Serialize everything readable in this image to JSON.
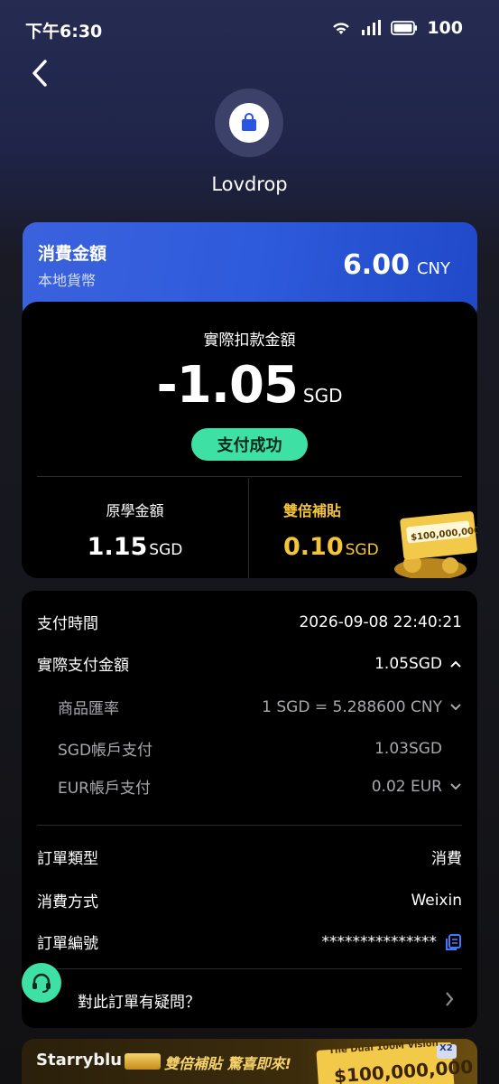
{
  "status_bar": {
    "time": "下午6:30",
    "battery": "100"
  },
  "merchant": {
    "name": "Lovdrop"
  },
  "spend_card": {
    "title": "消費金額",
    "subtitle": "本地貨幣",
    "amount": "6.00",
    "currency": "CNY"
  },
  "payment": {
    "title": "實際扣款金額",
    "amount": "-1.05",
    "currency": "SGD",
    "status": "支付成功",
    "original_label": "原學金額",
    "original_amount": "1.15",
    "original_currency": "SGD",
    "subsidy_label": "雙倍補貼",
    "subsidy_amount": "0.10",
    "subsidy_currency": "SGD"
  },
  "details": {
    "pay_time": {
      "label": "支付時間",
      "value": "2026-09-08 22:40:21"
    },
    "actual_amount": {
      "label": "實際支付金額",
      "value": "1.05SGD"
    },
    "rate": {
      "label": "商品匯率",
      "value": "1 SGD = 5.288600 CNY"
    },
    "sgd_account": {
      "label": "SGD帳戶支付",
      "value": "1.03SGD"
    },
    "eur_account": {
      "label": "EUR帳戶支付",
      "value": "0.02 EUR"
    },
    "order_type": {
      "label": "訂單類型",
      "value": "消費"
    },
    "method": {
      "label": "消費方式",
      "value": "Weixin"
    },
    "order_no": {
      "label": "訂單編號",
      "value": "***************"
    },
    "help": "對此訂單有疑問？"
  },
  "banner": {
    "brand": "Starryblu",
    "slogan": "雙倍補貼 驚喜即來!",
    "ticket_title": "The Dual 100M Vision",
    "ticket_amount": "$100,000,000",
    "ticket_badge": "X2"
  },
  "colors": {
    "accent_green": "#3ee0a4",
    "gold": "#f4c538",
    "blue_card": "#2e5bdc"
  }
}
